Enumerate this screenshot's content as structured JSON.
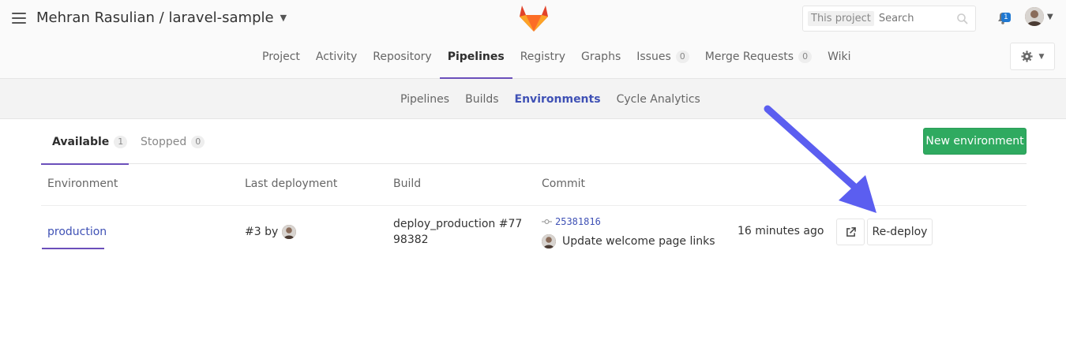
{
  "header": {
    "project_title": "Mehran Rasulian / laravel-sample",
    "search_scope": "This project",
    "search_placeholder": "Search",
    "todo_count": "1"
  },
  "nav": {
    "items": [
      {
        "label": "Project"
      },
      {
        "label": "Activity"
      },
      {
        "label": "Repository"
      },
      {
        "label": "Pipelines"
      },
      {
        "label": "Registry"
      },
      {
        "label": "Graphs"
      },
      {
        "label": "Issues",
        "count": "0"
      },
      {
        "label": "Merge Requests",
        "count": "0"
      },
      {
        "label": "Wiki"
      }
    ],
    "active": "Pipelines"
  },
  "subnav": {
    "items": [
      {
        "label": "Pipelines"
      },
      {
        "label": "Builds"
      },
      {
        "label": "Environments"
      },
      {
        "label": "Cycle Analytics"
      }
    ],
    "active": "Environments"
  },
  "tabs": {
    "available_label": "Available",
    "available_count": "1",
    "stopped_label": "Stopped",
    "stopped_count": "0"
  },
  "new_environment_label": "New environment",
  "table": {
    "headers": [
      "Environment",
      "Last deployment",
      "Build",
      "Commit"
    ],
    "rows": [
      {
        "environment": "production",
        "deployment": "#3 by",
        "build": "deploy_production #7798382",
        "commit_sha": "25381816",
        "commit_message": "Update welcome page links",
        "time_ago": "16 minutes ago",
        "redeploy_label": "Re-deploy"
      }
    ]
  },
  "colors": {
    "accent": "#6b4fbb",
    "link": "#3f51b5",
    "success": "#2faa60",
    "annotation_arrow": "#5b5ef0"
  }
}
